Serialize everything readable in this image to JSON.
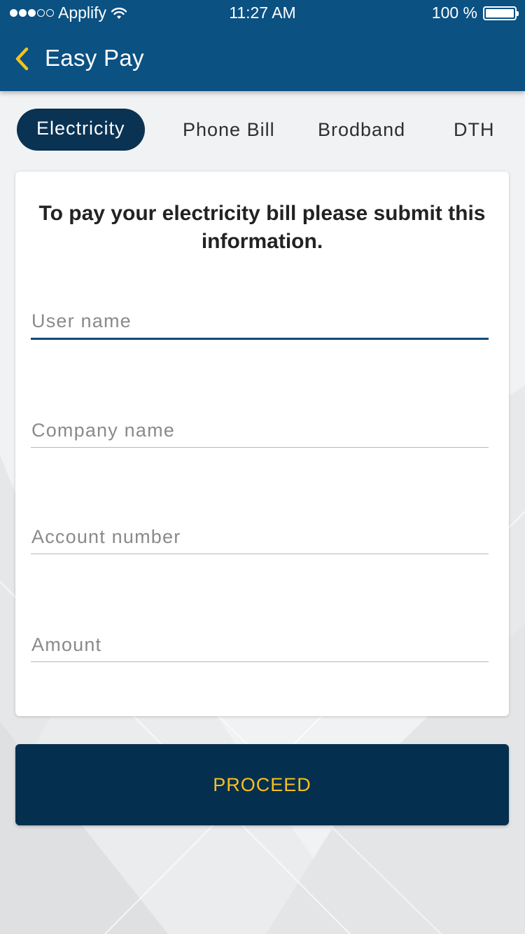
{
  "status_bar": {
    "carrier": "Applify",
    "time": "11:27 AM",
    "battery": "100 %",
    "signal_bars_filled": 3,
    "signal_bars_total": 5
  },
  "nav": {
    "title": "Easy Pay",
    "back_icon": "chevron-left-icon"
  },
  "tabs": [
    {
      "label": "Electricity",
      "active": true
    },
    {
      "label": "Phone Bill",
      "active": false
    },
    {
      "label": "Brodband",
      "active": false
    },
    {
      "label": "DTH",
      "active": false
    }
  ],
  "form": {
    "heading": "To pay your electricity bill please submit this information.",
    "fields": [
      {
        "placeholder": "User name",
        "value": "",
        "focused": true
      },
      {
        "placeholder": "Company name",
        "value": "",
        "focused": false
      },
      {
        "placeholder": "Account number",
        "value": "",
        "focused": false
      },
      {
        "placeholder": "Amount",
        "value": "",
        "focused": false
      }
    ]
  },
  "actions": {
    "proceed_label": "PROCEED"
  },
  "colors": {
    "header": "#0b5182",
    "tab_active": "#0a3253",
    "button": "#052f4f",
    "button_text": "#f5c21b",
    "back_icon": "#f5c21b",
    "focus_underline": "#0b4a7a"
  }
}
